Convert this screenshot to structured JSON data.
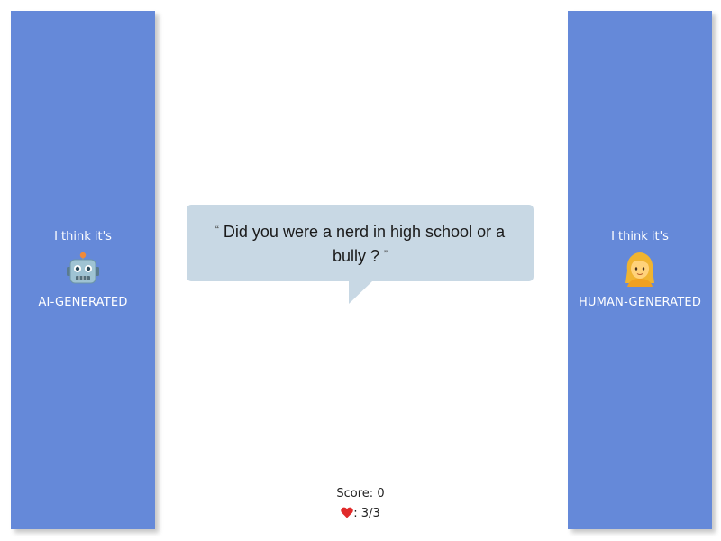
{
  "left_choice": {
    "prefix": "I think it's",
    "icon": "robot-face-icon",
    "label": "AI-GENERATED"
  },
  "right_choice": {
    "prefix": "I think it's",
    "icon": "woman-blonde-icon",
    "label": "HUMAN-GENERATED"
  },
  "question": {
    "open_quote": "“",
    "text": "Did you were a nerd in high school or a bully ?",
    "close_quote": "”"
  },
  "status": {
    "score_label": "Score:",
    "score_value": "0",
    "lives_icon": "red-heart-icon",
    "lives_text": ": 3/3"
  },
  "colors": {
    "panel": "#6589d9",
    "bubble": "#c8d8e4"
  }
}
